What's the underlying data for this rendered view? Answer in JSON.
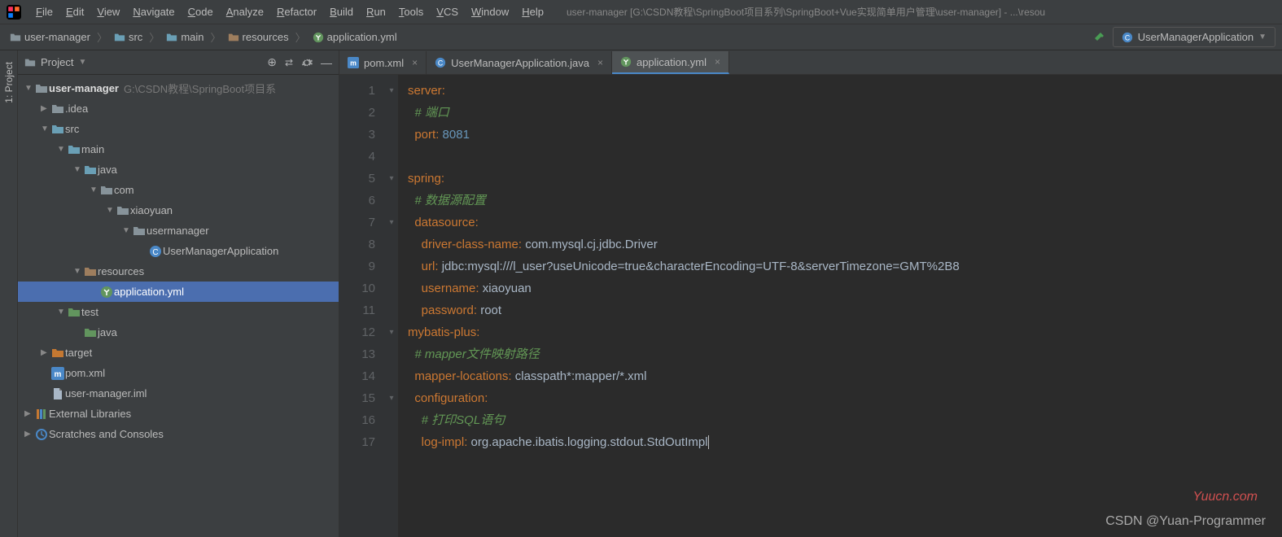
{
  "window_title": "user-manager [G:\\CSDN教程\\SpringBoot项目系列\\SpringBoot+Vue实现简单用户管理\\user-manager] - ...\\resou",
  "menubar": [
    "File",
    "Edit",
    "View",
    "Navigate",
    "Code",
    "Analyze",
    "Refactor",
    "Build",
    "Run",
    "Tools",
    "VCS",
    "Window",
    "Help"
  ],
  "breadcrumbs": [
    {
      "icon": "folder",
      "label": "user-manager"
    },
    {
      "icon": "folder-blue",
      "label": "src"
    },
    {
      "icon": "folder-blue",
      "label": "main"
    },
    {
      "icon": "folder-res",
      "label": "resources"
    },
    {
      "icon": "yml",
      "label": "application.yml"
    }
  ],
  "run_config": "UserManagerApplication",
  "sidebar_tab": "1: Project",
  "panel": {
    "title": "Project"
  },
  "tree": [
    {
      "depth": 0,
      "arrow": "▼",
      "icon": "folder",
      "label": "user-manager",
      "dim": "G:\\CSDN教程\\SpringBoot项目系",
      "bold": true
    },
    {
      "depth": 1,
      "arrow": "▶",
      "icon": "folder",
      "label": ".idea"
    },
    {
      "depth": 1,
      "arrow": "▼",
      "icon": "folder-blue",
      "label": "src"
    },
    {
      "depth": 2,
      "arrow": "▼",
      "icon": "folder-blue",
      "label": "main"
    },
    {
      "depth": 3,
      "arrow": "▼",
      "icon": "folder-blue",
      "label": "java"
    },
    {
      "depth": 4,
      "arrow": "▼",
      "icon": "folder",
      "label": "com"
    },
    {
      "depth": 5,
      "arrow": "▼",
      "icon": "folder",
      "label": "xiaoyuan"
    },
    {
      "depth": 6,
      "arrow": "▼",
      "icon": "folder",
      "label": "usermanager"
    },
    {
      "depth": 7,
      "arrow": "",
      "icon": "class",
      "label": "UserManagerApplication"
    },
    {
      "depth": 3,
      "arrow": "▼",
      "icon": "folder-res",
      "label": "resources"
    },
    {
      "depth": 4,
      "arrow": "",
      "icon": "yml",
      "label": "application.yml",
      "selected": true
    },
    {
      "depth": 2,
      "arrow": "▼",
      "icon": "folder-green",
      "label": "test"
    },
    {
      "depth": 3,
      "arrow": "",
      "icon": "folder-green",
      "label": "java"
    },
    {
      "depth": 1,
      "arrow": "▶",
      "icon": "folder-orange",
      "label": "target"
    },
    {
      "depth": 1,
      "arrow": "",
      "icon": "maven",
      "label": "pom.xml"
    },
    {
      "depth": 1,
      "arrow": "",
      "icon": "file",
      "label": "user-manager.iml"
    },
    {
      "depth": 0,
      "arrow": "▶",
      "icon": "lib",
      "label": "External Libraries"
    },
    {
      "depth": 0,
      "arrow": "▶",
      "icon": "scratch",
      "label": "Scratches and Consoles"
    }
  ],
  "tabs": [
    {
      "icon": "maven",
      "label": "pom.xml",
      "active": false
    },
    {
      "icon": "class",
      "label": "UserManagerApplication.java",
      "active": false
    },
    {
      "icon": "yml",
      "label": "application.yml",
      "active": true
    }
  ],
  "code": [
    {
      "n": 1,
      "fold": "▾",
      "segs": [
        {
          "t": "server",
          "c": "kw"
        },
        {
          "t": ":",
          "c": "kw"
        }
      ]
    },
    {
      "n": 2,
      "segs": [
        {
          "t": "  ",
          "c": ""
        },
        {
          "t": "# 端口",
          "c": "cmt-cn"
        }
      ]
    },
    {
      "n": 3,
      "segs": [
        {
          "t": "  ",
          "c": ""
        },
        {
          "t": "port",
          "c": "kw"
        },
        {
          "t": ": ",
          "c": "kw"
        },
        {
          "t": "8081",
          "c": "num"
        }
      ]
    },
    {
      "n": 4,
      "segs": []
    },
    {
      "n": 5,
      "fold": "▾",
      "segs": [
        {
          "t": "spring",
          "c": "kw"
        },
        {
          "t": ":",
          "c": "kw"
        }
      ]
    },
    {
      "n": 6,
      "segs": [
        {
          "t": "  ",
          "c": ""
        },
        {
          "t": "# 数据源配置",
          "c": "cmt-cn"
        }
      ]
    },
    {
      "n": 7,
      "fold": "▾",
      "segs": [
        {
          "t": "  ",
          "c": ""
        },
        {
          "t": "datasource",
          "c": "kw"
        },
        {
          "t": ":",
          "c": "kw"
        }
      ]
    },
    {
      "n": 8,
      "segs": [
        {
          "t": "    ",
          "c": ""
        },
        {
          "t": "driver-class-name",
          "c": "kw"
        },
        {
          "t": ": ",
          "c": "kw"
        },
        {
          "t": "com.mysql.cj.jdbc.Driver",
          "c": "cls"
        }
      ]
    },
    {
      "n": 9,
      "segs": [
        {
          "t": "    ",
          "c": ""
        },
        {
          "t": "url",
          "c": "kw"
        },
        {
          "t": ": ",
          "c": "kw"
        },
        {
          "t": "jdbc:mysql:///l_user?useUnicode=true&characterEncoding=UTF-8&serverTimezone=GMT%2B8",
          "c": "val"
        }
      ]
    },
    {
      "n": 10,
      "segs": [
        {
          "t": "    ",
          "c": ""
        },
        {
          "t": "username",
          "c": "kw"
        },
        {
          "t": ": ",
          "c": "kw"
        },
        {
          "t": "xiaoyuan",
          "c": "val"
        }
      ]
    },
    {
      "n": 11,
      "segs": [
        {
          "t": "    ",
          "c": ""
        },
        {
          "t": "password",
          "c": "kw"
        },
        {
          "t": ": ",
          "c": "kw"
        },
        {
          "t": "root",
          "c": "val"
        }
      ]
    },
    {
      "n": 12,
      "fold": "▾",
      "segs": [
        {
          "t": "mybatis-plus",
          "c": "kw"
        },
        {
          "t": ":",
          "c": "kw"
        }
      ]
    },
    {
      "n": 13,
      "segs": [
        {
          "t": "  ",
          "c": ""
        },
        {
          "t": "# mapper",
          "c": "cmt-cn"
        },
        {
          "t": "文件映射路径",
          "c": "cmt-cn"
        }
      ]
    },
    {
      "n": 14,
      "segs": [
        {
          "t": "  ",
          "c": ""
        },
        {
          "t": "mapper-locations",
          "c": "kw"
        },
        {
          "t": ": ",
          "c": "kw"
        },
        {
          "t": "classpath*:mapper/*.xml",
          "c": "val"
        }
      ]
    },
    {
      "n": 15,
      "fold": "▾",
      "segs": [
        {
          "t": "  ",
          "c": ""
        },
        {
          "t": "configuration",
          "c": "kw"
        },
        {
          "t": ":",
          "c": "kw"
        }
      ]
    },
    {
      "n": 16,
      "segs": [
        {
          "t": "    ",
          "c": ""
        },
        {
          "t": "# 打印SQL语句",
          "c": "cmt-cn"
        }
      ]
    },
    {
      "n": 17,
      "segs": [
        {
          "t": "    ",
          "c": ""
        },
        {
          "t": "log-impl",
          "c": "kw"
        },
        {
          "t": ": ",
          "c": "kw"
        },
        {
          "t": "org.apache.ibatis.logging.stdout.",
          "c": "cls"
        },
        {
          "t": "StdOutImpl",
          "c": "cls"
        },
        {
          "t": "",
          "c": "cursor"
        }
      ]
    }
  ],
  "watermark": "CSDN @Yuan-Programmer",
  "watermark2": "Yuucn.com"
}
